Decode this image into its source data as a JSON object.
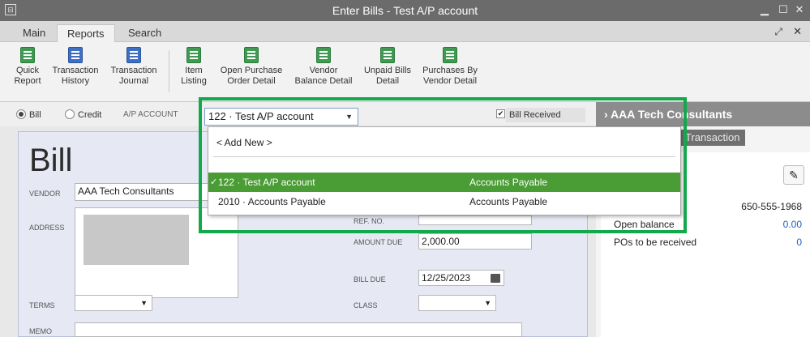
{
  "window": {
    "title": "Enter Bills - Test A/P account"
  },
  "tabs": [
    {
      "label": "Main"
    },
    {
      "label": "Reports"
    },
    {
      "label": "Search"
    }
  ],
  "toolbar": {
    "items": [
      {
        "label": "Quick\nReport",
        "icon": "quick-report-icon"
      },
      {
        "label": "Transaction\nHistory",
        "icon": "transaction-history-icon"
      },
      {
        "label": "Transaction\nJournal",
        "icon": "transaction-journal-icon"
      },
      {
        "label": "Item\nListing",
        "icon": "item-listing-icon"
      },
      {
        "label": "Open Purchase\nOrder Detail",
        "icon": "open-po-icon"
      },
      {
        "label": "Vendor\nBalance Detail",
        "icon": "vendor-balance-icon"
      },
      {
        "label": "Unpaid Bills\nDetail",
        "icon": "unpaid-bills-icon"
      },
      {
        "label": "Purchases By\nVendor Detail",
        "icon": "purchases-vendor-icon"
      }
    ]
  },
  "options": {
    "bill_label": "Bill",
    "credit_label": "Credit",
    "ap_account_label": "A/P ACCOUNT",
    "ap_account_value": "122 · Test A/P account",
    "bill_received_label": "Bill Received",
    "bill_received_checked": true
  },
  "form": {
    "title": "Bill",
    "vendor_label": "VENDOR",
    "vendor_value": "AAA Tech Consultants",
    "address_label": "ADDRESS",
    "ref_label": "REF. NO.",
    "amount_due_label": "AMOUNT DUE",
    "amount_due_value": "2,000.00",
    "bill_due_label": "BILL DUE",
    "bill_due_value": "12/25/2023",
    "terms_label": "TERMS",
    "class_label": "CLASS",
    "memo_label": "MEMO"
  },
  "dropdown": {
    "add_new": "< Add New >",
    "rows": [
      {
        "name": "122 · Test A/P account",
        "type": "Accounts Payable",
        "selected": true
      },
      {
        "name": "2010 · Accounts Payable",
        "type": "Accounts Payable",
        "selected": false
      }
    ]
  },
  "right_panel": {
    "vendor_name": "AAA Tech Consultants",
    "tab_label": "Transaction",
    "phone": "650-555-1968",
    "open_balance_label": "Open balance",
    "open_balance_value": "0.00",
    "pos_label": "POs to be received",
    "pos_value": "0"
  },
  "colors": {
    "highlight": "#13a84b",
    "selected_row": "#4a9c34"
  }
}
